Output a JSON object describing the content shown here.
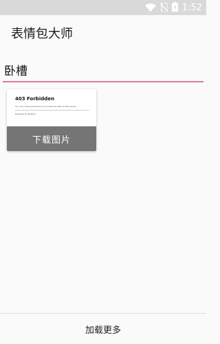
{
  "status_bar": {
    "time": "1:52",
    "icons": [
      "wifi-icon",
      "no-sim-icon",
      "battery-charging-icon"
    ]
  },
  "app_bar": {
    "title": "表情包大师"
  },
  "search": {
    "value": "卧槽"
  },
  "results": [
    {
      "thumb_title": "403 Forbidden",
      "thumb_body": "You don't have permission to access the URL on this server.",
      "thumb_footer": "Powered by Tengine",
      "download_label": "下载图片"
    }
  ],
  "footer": {
    "load_more_label": "加载更多"
  },
  "colors": {
    "accent": "#d979a0",
    "button": "#757575",
    "status_bar": "#d9d9d9"
  }
}
